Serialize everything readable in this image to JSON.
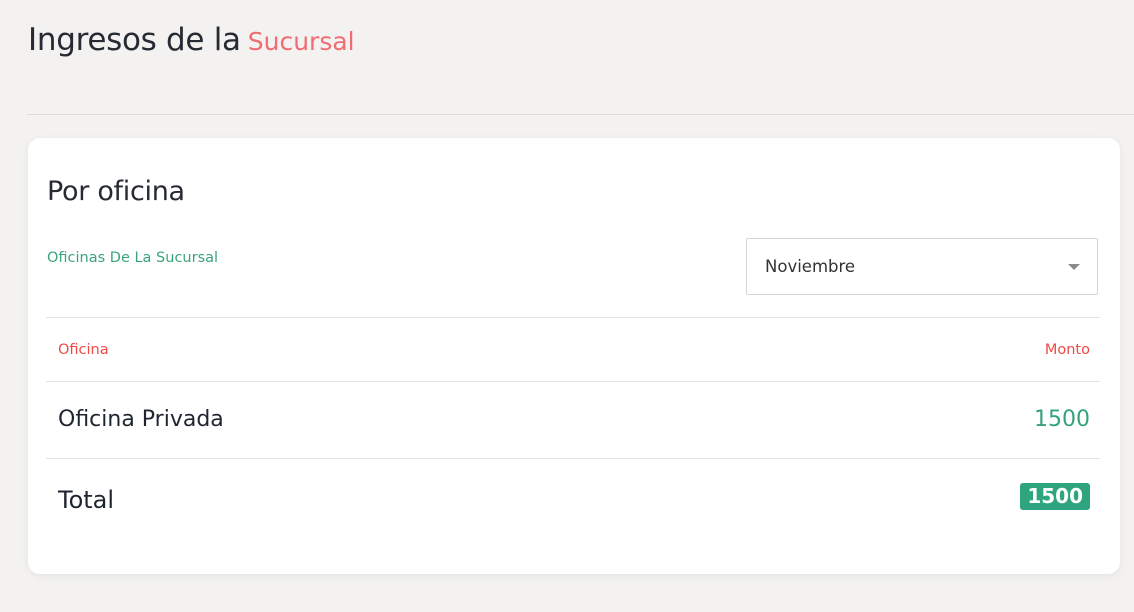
{
  "header": {
    "title_main": "Ingresos de la",
    "title_accent": "Sucursal"
  },
  "card": {
    "title": "Por oficina",
    "subtitle": "Oficinas De La Sucursal",
    "month_select": {
      "value": "Noviembre"
    },
    "table": {
      "columns": [
        "Oficina",
        "Monto"
      ],
      "rows": [
        {
          "oficina": "Oficina Privada",
          "monto": "1500"
        }
      ],
      "total_label": "Total",
      "total_value": "1500"
    }
  },
  "colors": {
    "accent_red": "#f06c72",
    "header_red": "#ef4a45",
    "green": "#35a37a",
    "badge_green": "#2ea57e"
  },
  "icons": {
    "select_arrow": "chevron-down-icon"
  }
}
